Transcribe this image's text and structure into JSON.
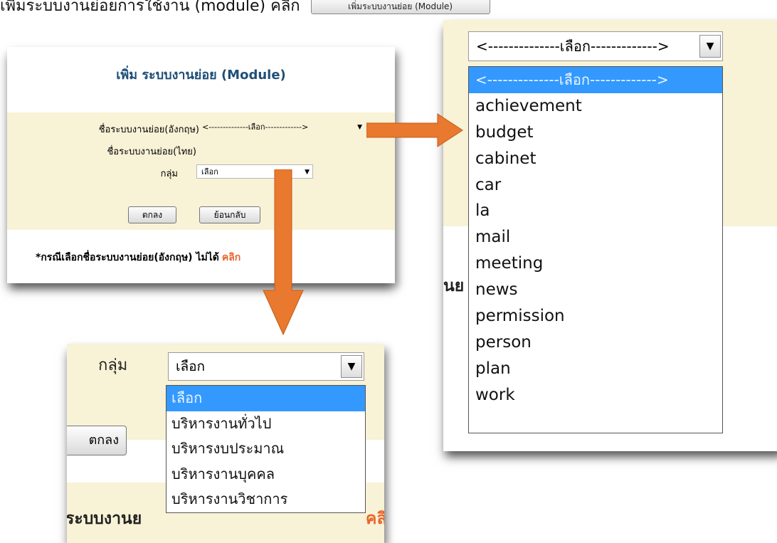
{
  "caption": {
    "text": "เพิ่มระบบงานย่อยการใช้งาน (module) คลิก",
    "button_label": "เพิ่มระบบงานย่อย (Module)"
  },
  "form": {
    "title": "เพิ่ม ระบบงานย่อย (Module)",
    "fields": [
      {
        "label": "ชื่อระบบงานย่อย(อังกฤษ)",
        "value": "<--------------เลือก------------->"
      },
      {
        "label": "ชื่อระบบงานย่อย(ไทย)",
        "value": ""
      },
      {
        "label": "กลุ่ม",
        "value": "เลือก"
      }
    ],
    "ok_label": "ตกลง",
    "back_label": "ย้อนกลับ",
    "note_text": "*กรณีเลือกชื่อระบบงานย่อย(อังกฤษ) ไม่ได้",
    "note_link": "คลิก"
  },
  "module_dropdown": {
    "selected_value": "<--------------เลือก------------->",
    "options": [
      "<--------------เลือก------------->",
      "achievement",
      "budget",
      "cabinet",
      "car",
      "la",
      "mail",
      "meeting",
      "news",
      "permission",
      "person",
      "plan",
      "work"
    ],
    "highlighted_index": 0,
    "background_fragment": "นย"
  },
  "group_dropdown": {
    "label": "กลุ่ม",
    "selected_value": "เลือก",
    "options": [
      "เลือก",
      "บริหารงานทั่วไป",
      "บริหารงบประมาณ",
      "บริหารงานบุคคล",
      "บริหารงานวิชาการ"
    ],
    "highlighted_index": 0,
    "ok_fragment": "ตกลง",
    "text_fragment": "ระบบงานย",
    "click_fragment": "คลิ"
  },
  "colors": {
    "title": "#1f4f77",
    "band": "#f8f2d6",
    "highlight": "#3399ff",
    "link": "#e8642a",
    "arrow": "#e8792f"
  },
  "icons": [
    "dropdown-arrow-icon",
    "pointer-arrow-icon"
  ]
}
